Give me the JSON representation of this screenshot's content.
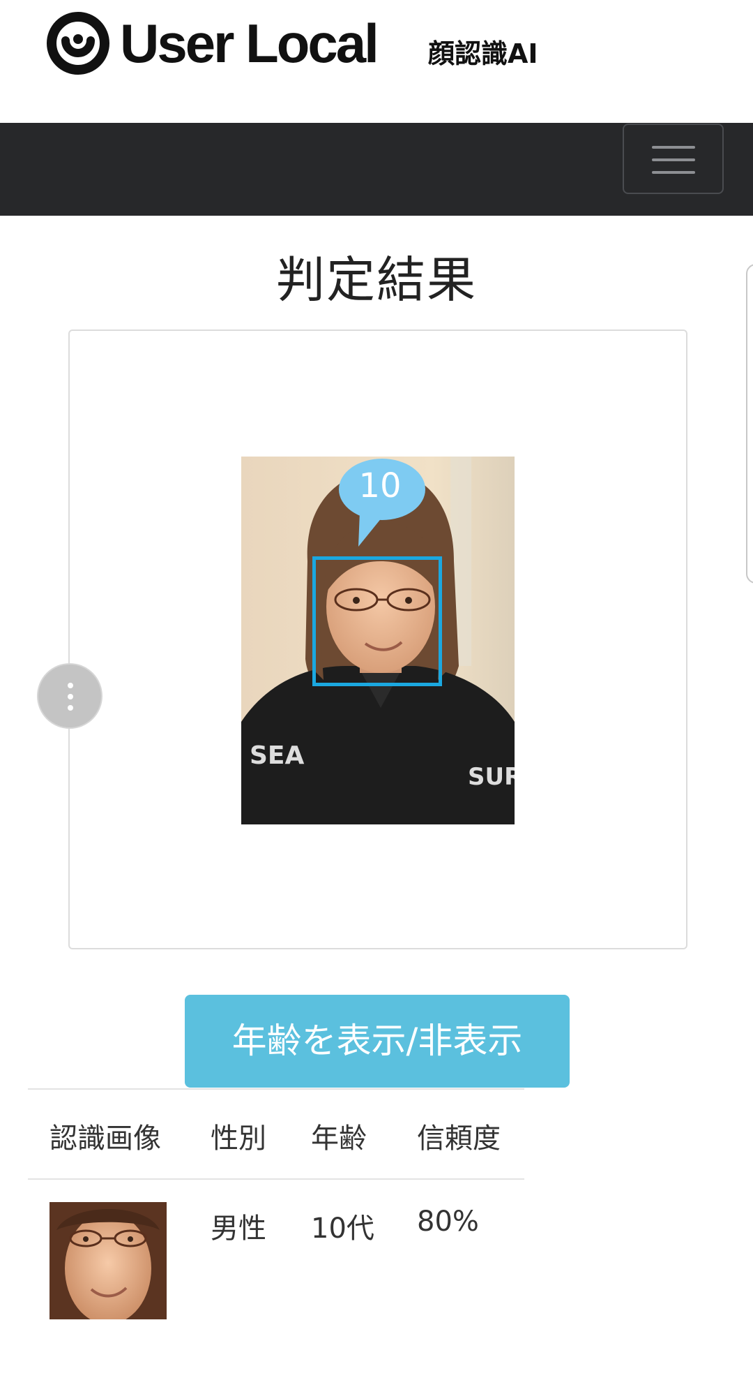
{
  "header": {
    "brand": "User Local",
    "product": "顔認識AI"
  },
  "page": {
    "title": "判定結果"
  },
  "result": {
    "age_bubble": "10",
    "bubble_color": "#7ecbf2",
    "box_color": "#1ba8e0"
  },
  "toggle_button": {
    "label": "年齢を表示/非表示",
    "color": "#5bc0de"
  },
  "table": {
    "headers": [
      "認識画像",
      "性別",
      "年齢",
      "信頼度"
    ],
    "rows": [
      {
        "gender": "男性",
        "age": "10代",
        "confidence": "80%"
      }
    ]
  },
  "icons": {
    "menu": "hamburger-menu-icon",
    "logo": "user-local-logo-icon",
    "more": "more-vertical-icon"
  }
}
